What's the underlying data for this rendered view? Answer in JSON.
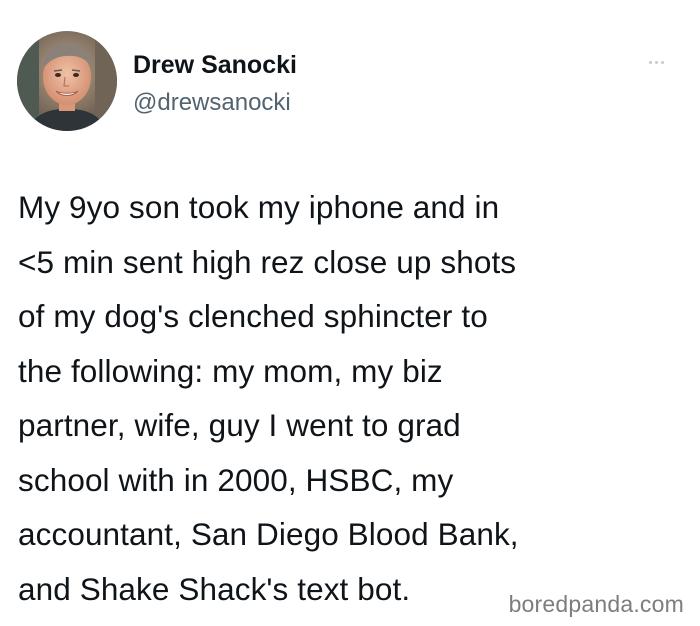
{
  "tweet": {
    "author_name": "Drew Sanocki",
    "author_handle": "@drewsanocki",
    "more_icon": "ellipsis-icon",
    "text": "My 9yo son took my iphone and in\n<5 min sent high rez close up shots\nof my dog's clenched sphincter to\nthe following: my mom, my biz\npartner, wife, guy I went to grad\nschool with in 2000, HSBC, my\naccountant, San Diego Blood Bank,\nand Shake Shack's text bot."
  },
  "watermark": {
    "text": "boredpanda.com"
  },
  "colors": {
    "text": "#0f1419",
    "handle": "#536471",
    "watermark": "#7d7d7d",
    "background": "#ffffff"
  }
}
